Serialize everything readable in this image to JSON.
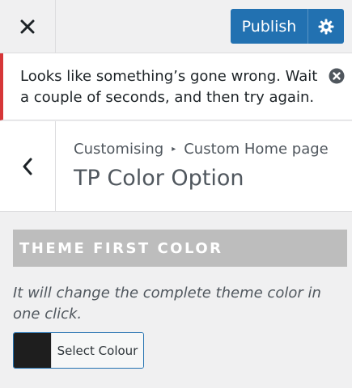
{
  "header": {
    "publish_label": "Publish"
  },
  "notice": {
    "message": "Looks like something’s gone wrong. Wait a couple of seconds, and then try again."
  },
  "section": {
    "breadcrumb_root": "Customising",
    "breadcrumb_current": "Custom Home page",
    "title": "TP Color Option"
  },
  "control": {
    "title": "THEME FIRST COLOR",
    "description": "It will change the complete theme color in one click.",
    "picker_label": "Select Colour",
    "current_color": "#1e1e1e"
  },
  "colors": {
    "accent": "#2271b1",
    "error": "#d63638",
    "control_title_bg": "#bdbdbd"
  },
  "icons": [
    "close-icon",
    "gear-icon",
    "dismiss-icon",
    "chevron-left-icon",
    "breadcrumb-arrow-icon"
  ]
}
